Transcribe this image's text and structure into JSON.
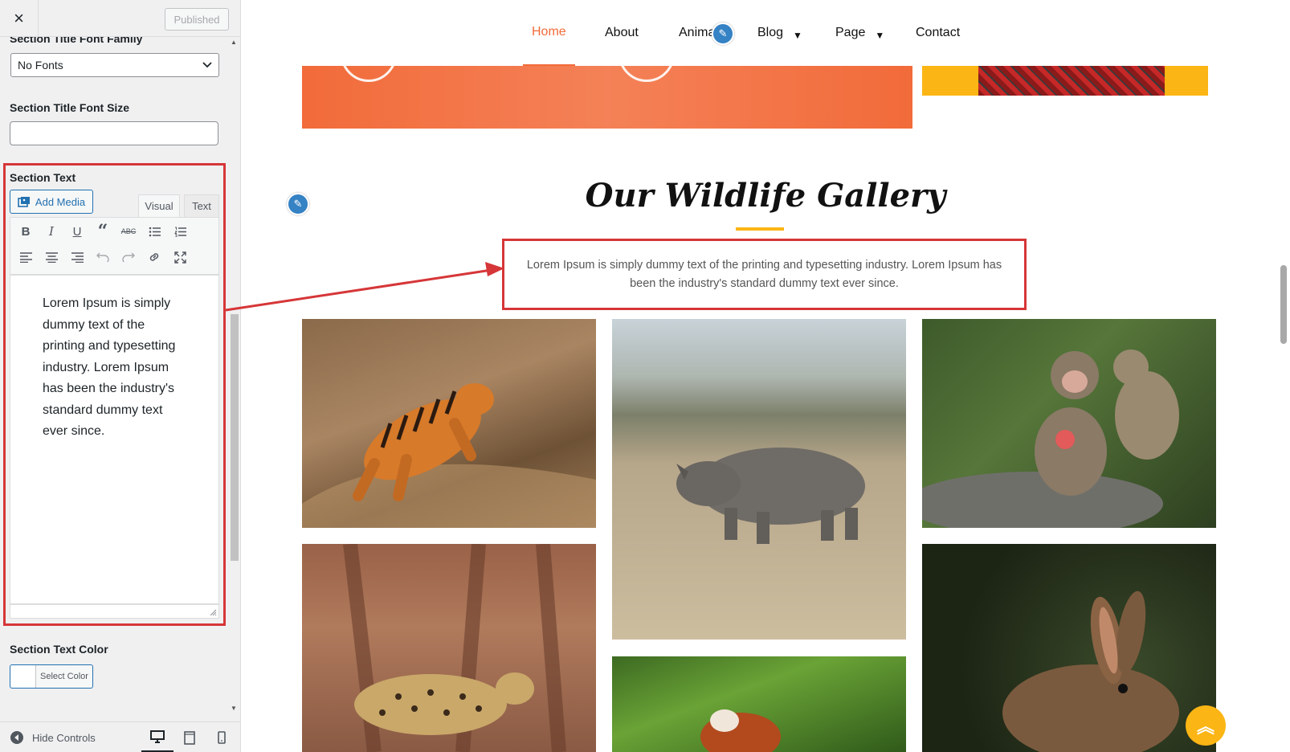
{
  "sidebar": {
    "close_label": "×",
    "published_label": "Published",
    "title_font_family_label": "Section Title Font Family",
    "title_font_family_value": "No Fonts",
    "title_font_size_label": "Section Title Font Size",
    "title_font_size_value": "",
    "section_text_label": "Section Text",
    "add_media_label": "Add Media",
    "tab_visual": "Visual",
    "tab_text": "Text",
    "editor_content": "Lorem Ipsum is simply dummy text of the printing and typesetting industry. Lorem Ipsum has been the industry's standard dummy text ever since.",
    "text_color_label": "Section Text Color",
    "select_color_label": "Select Color",
    "hide_controls_label": "Hide Controls"
  },
  "nav": {
    "items": [
      {
        "label": "Home",
        "active": true
      },
      {
        "label": "About"
      },
      {
        "label": "Anima"
      },
      {
        "label": "Blog",
        "has_dropdown": true
      },
      {
        "label": "Page",
        "has_dropdown": true
      },
      {
        "label": "Contact"
      }
    ]
  },
  "gallery": {
    "title": "Our Wildlife Gallery",
    "description": "Lorem Ipsum is simply dummy text of the printing and typesetting industry. Lorem Ipsum has been the industry's standard dummy text ever since.",
    "photos": [
      "tiger",
      "rhino",
      "monkeys",
      "leopard",
      "red-panda",
      "rabbit"
    ]
  },
  "colors": {
    "accent": "#f26b3a",
    "yellow": "#fbb514",
    "highlight": "#d63638",
    "wp_blue": "#2271b1"
  }
}
